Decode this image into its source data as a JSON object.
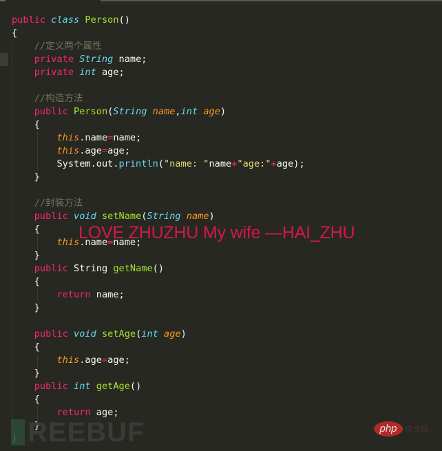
{
  "editor": {
    "theme_colors": {
      "background": "#272822",
      "keyword": "#f92672",
      "type": "#66d9ef",
      "function": "#a6e22e",
      "parameter": "#fd971f",
      "comment": "#75715e",
      "string": "#e6db74",
      "text": "#f8f8f2"
    },
    "lines": [
      [
        {
          "c": "kw",
          "t": "public"
        },
        {
          "c": "",
          "t": " "
        },
        {
          "c": "ty",
          "t": "class"
        },
        {
          "c": "",
          "t": " "
        },
        {
          "c": "fn",
          "t": "Person"
        },
        {
          "c": "",
          "t": "()"
        }
      ],
      [
        {
          "c": "",
          "t": "{"
        }
      ],
      [
        {
          "c": "",
          "t": "    "
        },
        {
          "c": "cm",
          "t": "//定义两个属性"
        }
      ],
      [
        {
          "c": "",
          "t": "    "
        },
        {
          "c": "kw",
          "t": "private"
        },
        {
          "c": "",
          "t": " "
        },
        {
          "c": "ty",
          "t": "String"
        },
        {
          "c": "",
          "t": " name;"
        }
      ],
      [
        {
          "c": "",
          "t": "    "
        },
        {
          "c": "kw",
          "t": "private"
        },
        {
          "c": "",
          "t": " "
        },
        {
          "c": "ty",
          "t": "int"
        },
        {
          "c": "",
          "t": " age;"
        }
      ],
      [
        {
          "c": "",
          "t": ""
        }
      ],
      [
        {
          "c": "",
          "t": "    "
        },
        {
          "c": "cm",
          "t": "//构造方法"
        }
      ],
      [
        {
          "c": "",
          "t": "    "
        },
        {
          "c": "kw",
          "t": "public"
        },
        {
          "c": "",
          "t": " "
        },
        {
          "c": "fn",
          "t": "Person"
        },
        {
          "c": "",
          "t": "("
        },
        {
          "c": "ty",
          "t": "String"
        },
        {
          "c": "",
          "t": " "
        },
        {
          "c": "pm",
          "t": "name"
        },
        {
          "c": "",
          "t": ","
        },
        {
          "c": "ty",
          "t": "int"
        },
        {
          "c": "",
          "t": " "
        },
        {
          "c": "pm",
          "t": "age"
        },
        {
          "c": "",
          "t": ")"
        }
      ],
      [
        {
          "c": "",
          "t": "    {"
        }
      ],
      [
        {
          "c": "",
          "t": "        "
        },
        {
          "c": "th",
          "t": "this"
        },
        {
          "c": "",
          "t": ".name"
        },
        {
          "c": "op",
          "t": "="
        },
        {
          "c": "",
          "t": "name;"
        }
      ],
      [
        {
          "c": "",
          "t": "        "
        },
        {
          "c": "th",
          "t": "this"
        },
        {
          "c": "",
          "t": ".age"
        },
        {
          "c": "op",
          "t": "="
        },
        {
          "c": "",
          "t": "age;"
        }
      ],
      [
        {
          "c": "",
          "t": "        System.out."
        },
        {
          "c": "bi",
          "t": "println"
        },
        {
          "c": "",
          "t": "("
        },
        {
          "c": "st",
          "t": "\"name: \""
        },
        {
          "c": "",
          "t": "name"
        },
        {
          "c": "op",
          "t": "+"
        },
        {
          "c": "st",
          "t": "\"age:\""
        },
        {
          "c": "op",
          "t": "+"
        },
        {
          "c": "",
          "t": "age);"
        }
      ],
      [
        {
          "c": "",
          "t": "    }"
        }
      ],
      [
        {
          "c": "",
          "t": ""
        }
      ],
      [
        {
          "c": "",
          "t": "    "
        },
        {
          "c": "cm",
          "t": "//封装方法"
        }
      ],
      [
        {
          "c": "",
          "t": "    "
        },
        {
          "c": "kw",
          "t": "public"
        },
        {
          "c": "",
          "t": " "
        },
        {
          "c": "ty",
          "t": "void"
        },
        {
          "c": "",
          "t": " "
        },
        {
          "c": "fn",
          "t": "setName"
        },
        {
          "c": "",
          "t": "("
        },
        {
          "c": "ty",
          "t": "String"
        },
        {
          "c": "",
          "t": " "
        },
        {
          "c": "pm",
          "t": "name"
        },
        {
          "c": "",
          "t": ")"
        }
      ],
      [
        {
          "c": "",
          "t": "    {"
        }
      ],
      [
        {
          "c": "",
          "t": "        "
        },
        {
          "c": "th",
          "t": "this"
        },
        {
          "c": "",
          "t": ".name"
        },
        {
          "c": "op",
          "t": "="
        },
        {
          "c": "",
          "t": "name;"
        }
      ],
      [
        {
          "c": "",
          "t": "    }"
        }
      ],
      [
        {
          "c": "",
          "t": "    "
        },
        {
          "c": "kw",
          "t": "public"
        },
        {
          "c": "",
          "t": " String "
        },
        {
          "c": "fn",
          "t": "getName"
        },
        {
          "c": "",
          "t": "()"
        }
      ],
      [
        {
          "c": "",
          "t": "    {"
        }
      ],
      [
        {
          "c": "",
          "t": "        "
        },
        {
          "c": "kw",
          "t": "return"
        },
        {
          "c": "",
          "t": " name;"
        }
      ],
      [
        {
          "c": "",
          "t": "    }"
        }
      ],
      [
        {
          "c": "",
          "t": ""
        }
      ],
      [
        {
          "c": "",
          "t": "    "
        },
        {
          "c": "kw",
          "t": "public"
        },
        {
          "c": "",
          "t": " "
        },
        {
          "c": "ty",
          "t": "void"
        },
        {
          "c": "",
          "t": " "
        },
        {
          "c": "fn",
          "t": "setAge"
        },
        {
          "c": "",
          "t": "("
        },
        {
          "c": "ty",
          "t": "int"
        },
        {
          "c": "",
          "t": " "
        },
        {
          "c": "pm",
          "t": "age"
        },
        {
          "c": "",
          "t": ")"
        }
      ],
      [
        {
          "c": "",
          "t": "    {"
        }
      ],
      [
        {
          "c": "",
          "t": "        "
        },
        {
          "c": "th",
          "t": "this"
        },
        {
          "c": "",
          "t": ".age"
        },
        {
          "c": "op",
          "t": "="
        },
        {
          "c": "",
          "t": "age;"
        }
      ],
      [
        {
          "c": "",
          "t": "    }"
        }
      ],
      [
        {
          "c": "",
          "t": "    "
        },
        {
          "c": "kw",
          "t": "public"
        },
        {
          "c": "",
          "t": " "
        },
        {
          "c": "ty",
          "t": "int"
        },
        {
          "c": "",
          "t": " "
        },
        {
          "c": "fn",
          "t": "getAge"
        },
        {
          "c": "",
          "t": "()"
        }
      ],
      [
        {
          "c": "",
          "t": "    {"
        }
      ],
      [
        {
          "c": "",
          "t": "        "
        },
        {
          "c": "kw",
          "t": "return"
        },
        {
          "c": "",
          "t": " age;"
        }
      ],
      [
        {
          "c": "",
          "t": "    }"
        }
      ],
      [
        {
          "c": "",
          "t": "}"
        }
      ]
    ]
  },
  "overlay": {
    "caption": "LOVE ZHUZHU My wife —HAI_ZHU",
    "caption_color": "#d5174a"
  },
  "watermarks": {
    "freebuf": "REEBUF",
    "php_logo": "php",
    "php_cn": "中文网"
  }
}
